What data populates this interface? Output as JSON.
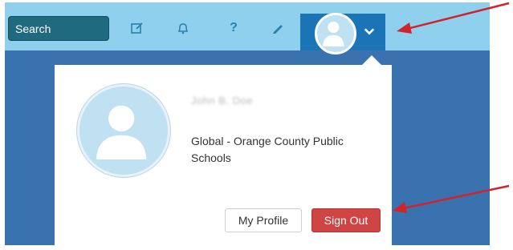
{
  "header": {
    "search_label": "Search",
    "icons": [
      "edit-icon",
      "bell-icon",
      "help-icon",
      "pencil-icon"
    ],
    "help_glyph": "?"
  },
  "profile_menu": {
    "user_name": "John B. Doe",
    "organization": "Global - Orange County Public Schools",
    "my_profile_label": "My Profile",
    "sign_out_label": "Sign Out"
  },
  "colors": {
    "header_bg": "#8fd0ef",
    "profile_tab_bg": "#1a74b6",
    "sign_out_bg": "#cf4444",
    "annotation_arrow": "#d0232a"
  }
}
